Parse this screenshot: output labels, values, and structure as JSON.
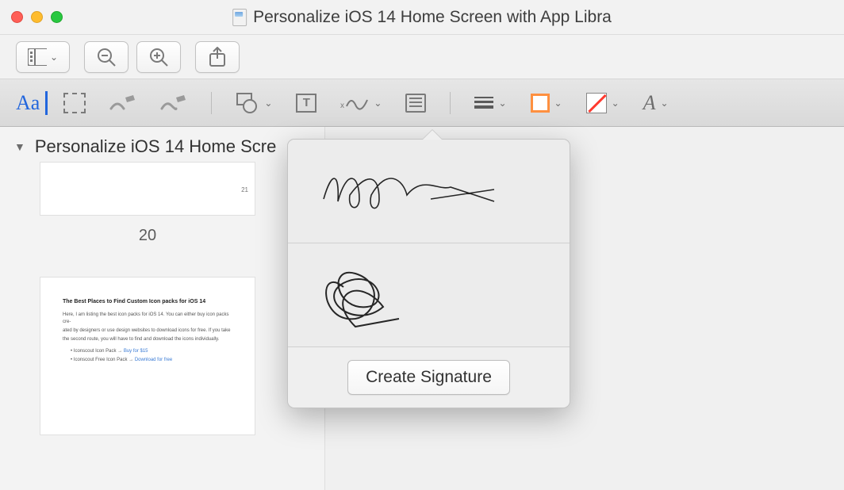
{
  "window": {
    "title": "Personalize iOS 14 Home Screen with App Libra"
  },
  "sidebar": {
    "doc_title": "Personalize iOS 14 Home Scre",
    "thumb_small_num": "21",
    "page_label": "20",
    "thumb_big": {
      "heading": "The Best Places to Find Custom Icon packs for iOS 14",
      "line1": "Here, I am listing the best icon packs for iOS 14. You can either buy icon packs cre-",
      "line2": "ated by designers or use design websites to download icons for free. If you take",
      "line3": "the second route, you will have to find and download the icons individually.",
      "bullet1_pre": "Iconscout Icon Pack → ",
      "bullet1_link": "Buy for $15",
      "bullet2_pre": "Iconscout Free Icon Pack → ",
      "bullet2_link": "Download for free"
    }
  },
  "toolbar2": {
    "aa_label": "Aa"
  },
  "popover": {
    "create_label": "Create Signature"
  }
}
